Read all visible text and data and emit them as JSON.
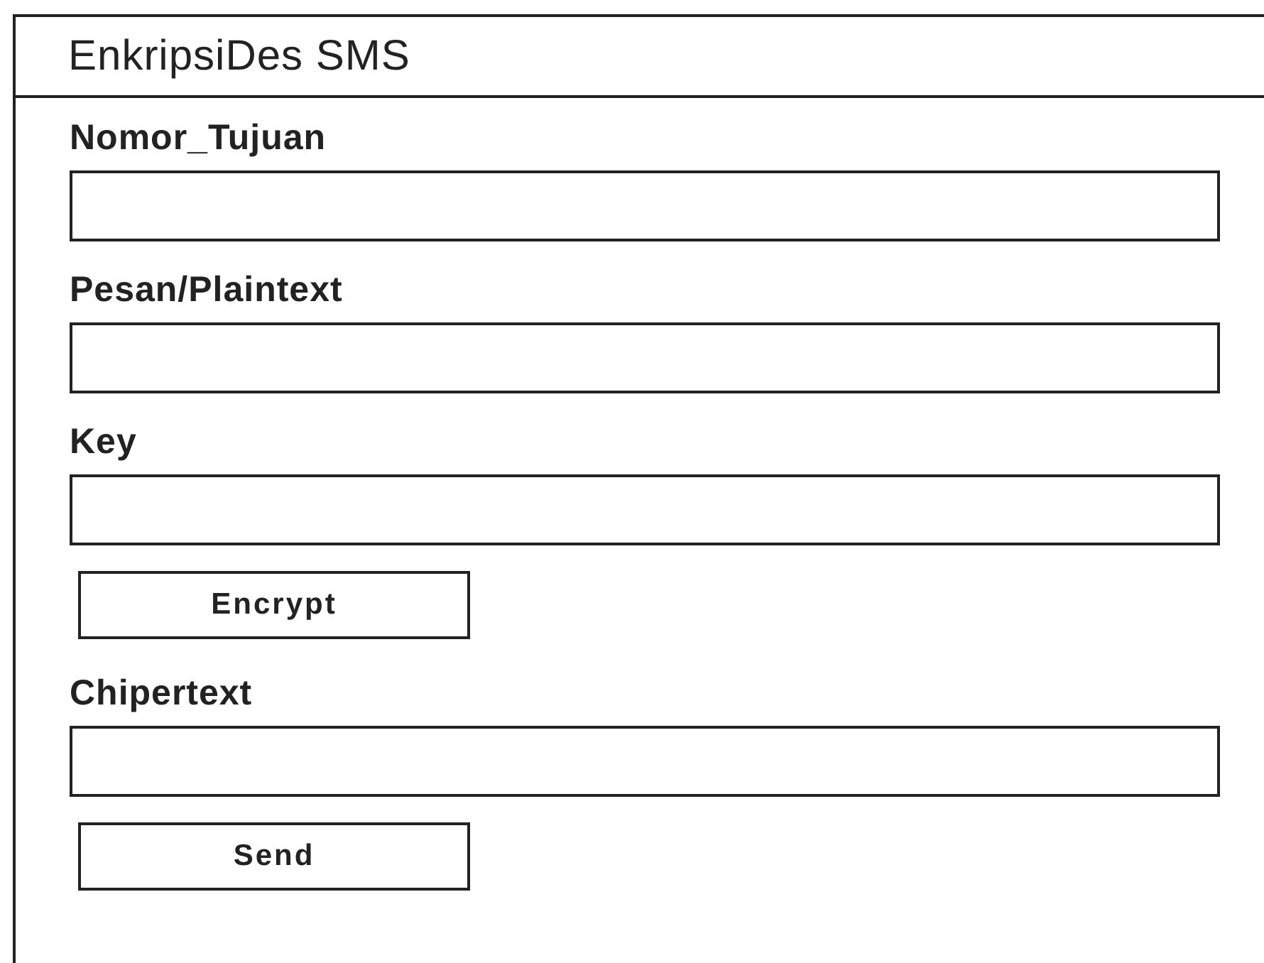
{
  "window": {
    "title": "EnkripsiDes SMS"
  },
  "items": [
    {
      "kind": "field",
      "label": "Nomor_Tujuan"
    },
    {
      "kind": "field",
      "label": "Pesan/Plaintext"
    },
    {
      "kind": "field",
      "label": "Key"
    },
    {
      "kind": "button",
      "label": "Encrypt"
    },
    {
      "kind": "field",
      "label": "Chipertext"
    },
    {
      "kind": "button",
      "label": "Send"
    }
  ]
}
